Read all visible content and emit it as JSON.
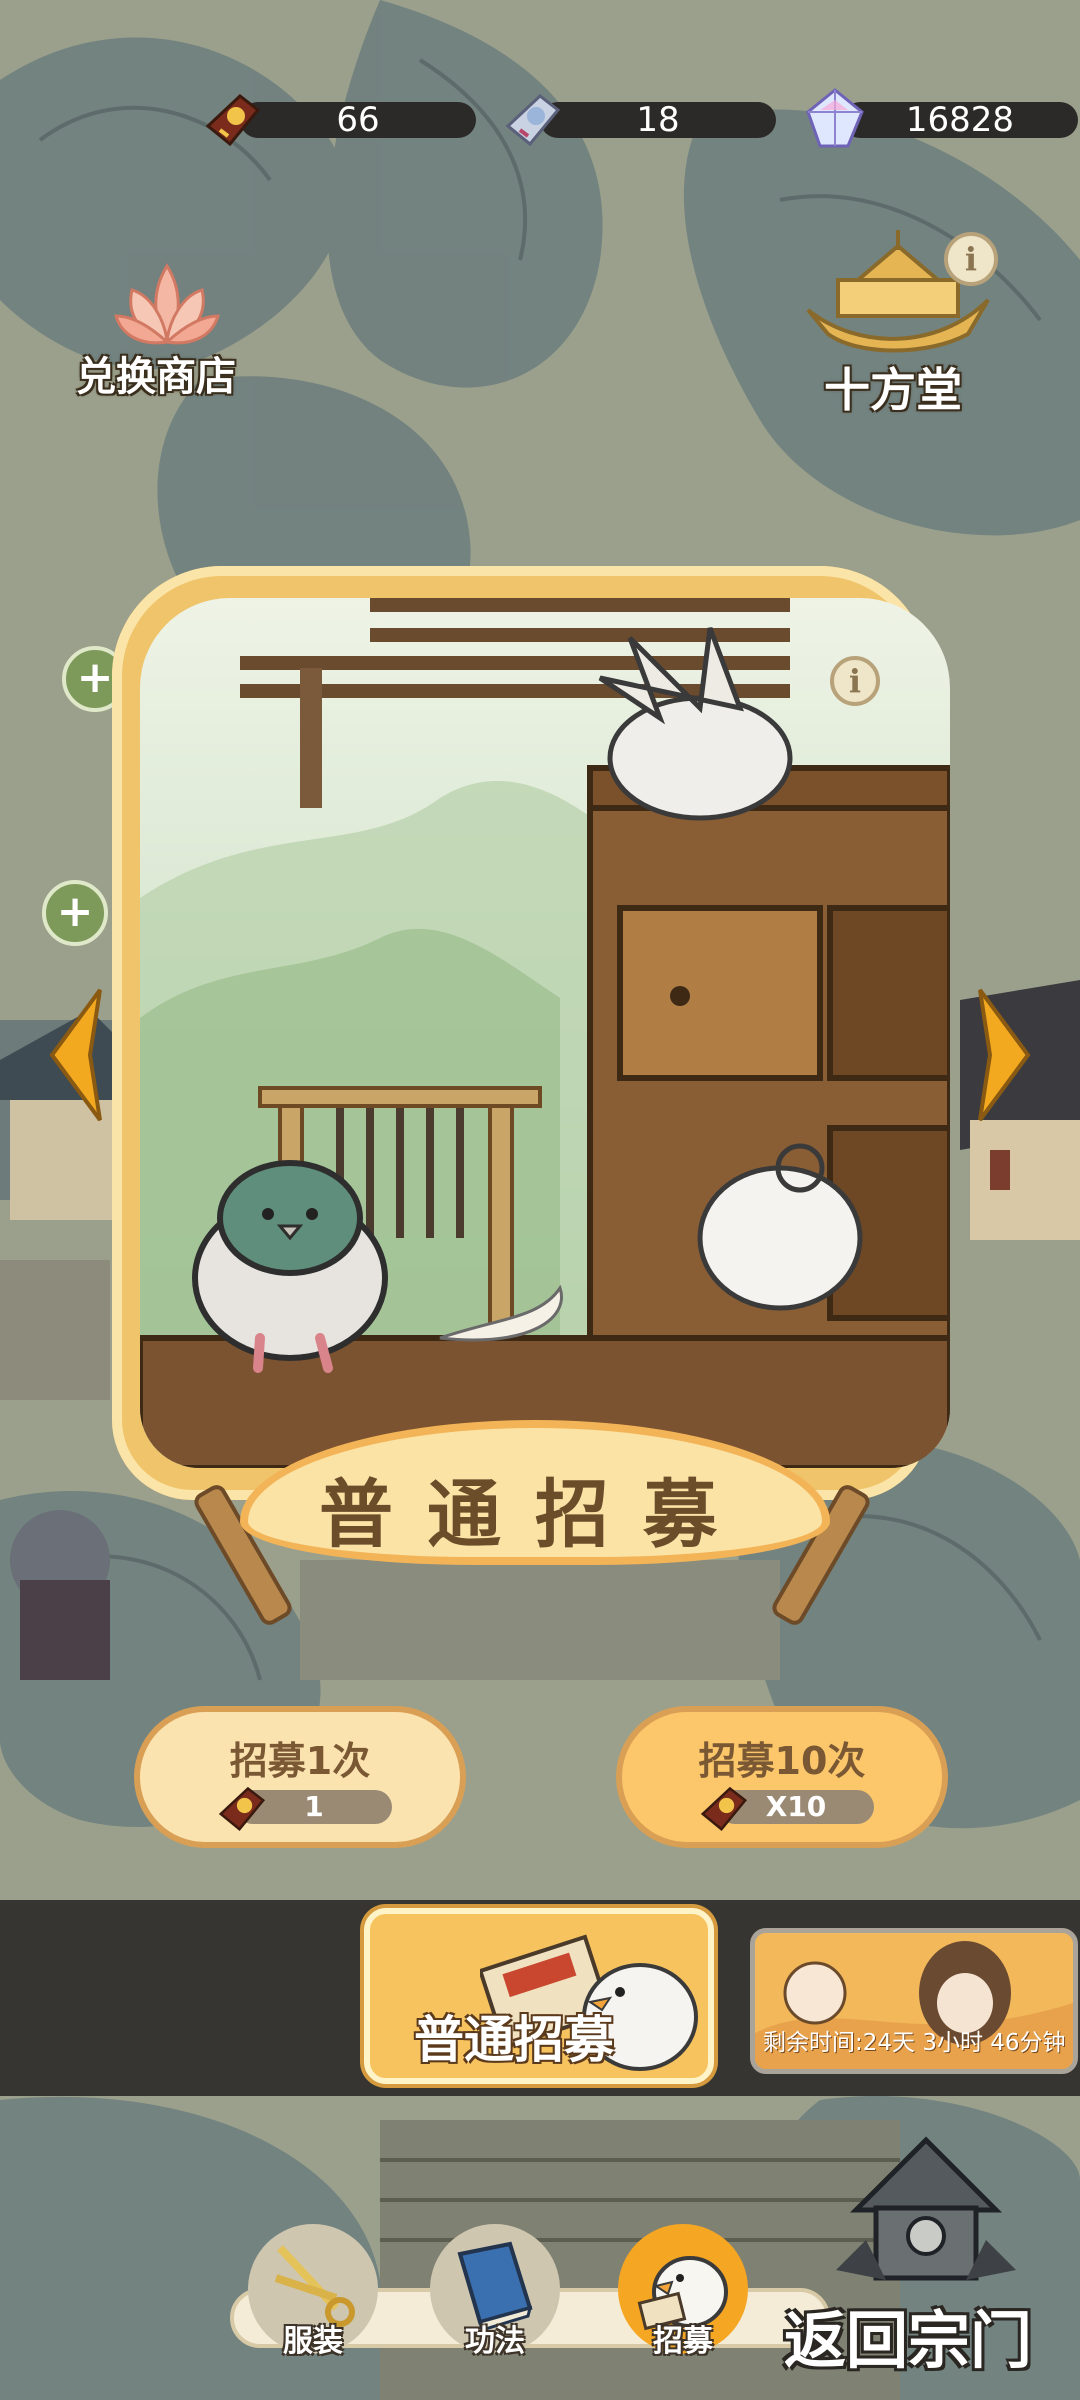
{
  "currencies": [
    {
      "icon": "recruit-token-icon",
      "value": "66"
    },
    {
      "icon": "silver-token-icon",
      "value": "18"
    },
    {
      "icon": "crystal-icon",
      "value": "16828"
    }
  ],
  "shop": {
    "icon": "lotus-icon",
    "label": "兑换商店"
  },
  "hall": {
    "icon": "golden-boat-icon",
    "label": "十方堂"
  },
  "banner": {
    "title": "普通招募"
  },
  "recruit_once": {
    "label": "招募1次",
    "cost_icon": "recruit-token-icon",
    "cost": "1"
  },
  "recruit_ten": {
    "label": "招募10次",
    "cost_icon": "recruit-token-icon",
    "cost": "X10"
  },
  "tabs": {
    "normal": {
      "label": "普通招募"
    },
    "event": {
      "remaining": "剩余时间:24天 3小时 46分钟"
    }
  },
  "nav": {
    "items": [
      {
        "label": "服装",
        "icon": "scissors-icon"
      },
      {
        "label": "功法",
        "icon": "book-icon"
      },
      {
        "label": "招募",
        "icon": "pigeon-icon"
      }
    ],
    "back": "返回宗门"
  },
  "colors": {
    "accent": "#f7c35f",
    "frame": "#f0c46a",
    "dark_band": "#282624"
  }
}
